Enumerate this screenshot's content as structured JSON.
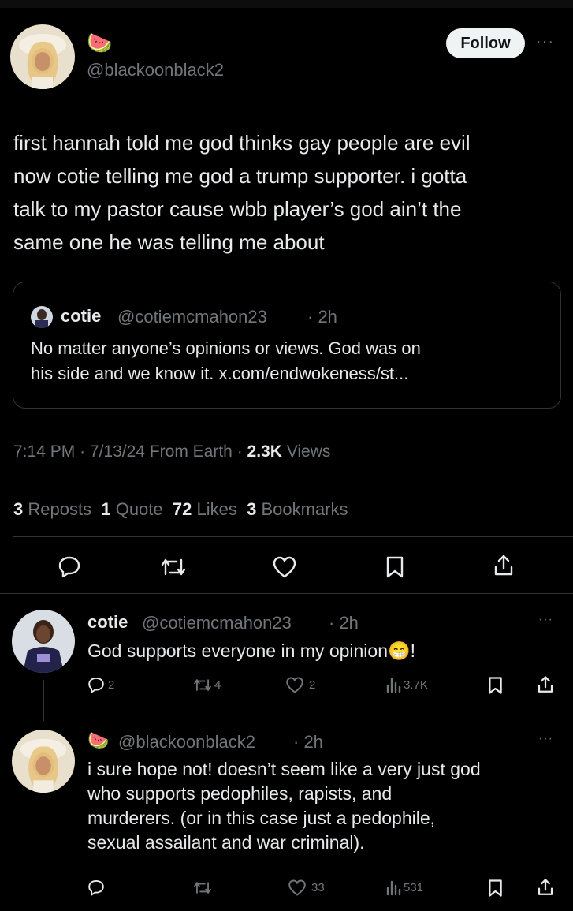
{
  "main_tweet": {
    "emoji": "🍉",
    "handle": "@blackoonblack2",
    "follow_label": "Follow",
    "more": "···",
    "text_lines": [
      "first hannah told me god thinks gay people are evil",
      "now cotie telling me god a trump supporter. i gotta",
      "talk to my pastor cause wbb player’s god ain’t the",
      "same one he was telling me about"
    ],
    "quote": {
      "name": "cotie",
      "handle": "@cotiemcmahon23",
      "time": "· 2h",
      "lines": [
        "No matter anyone’s opinions or views. God was on",
        "his side and we know it. x.com/endwokeness/st..."
      ]
    },
    "meta": {
      "time": "7:14 PM",
      "date": "· 7/13/24",
      "source": "From Earth",
      "sep": "·",
      "views_count": "2.3K",
      "views_label": "Views"
    },
    "stats": {
      "reposts_count": "3",
      "reposts_label": "Reposts",
      "quotes_count": "1",
      "quotes_label": "Quote",
      "likes_count": "72",
      "likes_label": "Likes",
      "bookmarks_count": "3",
      "bookmarks_label": "Bookmarks"
    }
  },
  "reply1": {
    "name": "cotie",
    "handle": "@cotiemcmahon23",
    "time": "· 2h",
    "text": "God supports everyone in my opinion",
    "emoji": "😁",
    "text_end": "!",
    "more": "···",
    "replies": "2",
    "reposts": "4",
    "likes": "2",
    "views": "3.7K"
  },
  "reply2": {
    "emoji": "🍉",
    "handle": "@blackoonblack2",
    "time": "· 2h",
    "more": "···",
    "text_lines": [
      "i sure hope not! doesn’t seem like a very just god",
      "who supports pedophiles, rapists, and",
      "murderers. (or in this case just a pedophile,",
      "sexual assailant and war criminal)."
    ],
    "likes": "33",
    "views": "531"
  },
  "colors": {
    "background": "#000000",
    "text": "#e7e9ea",
    "muted": "#71767b",
    "border": "#2f3336"
  }
}
